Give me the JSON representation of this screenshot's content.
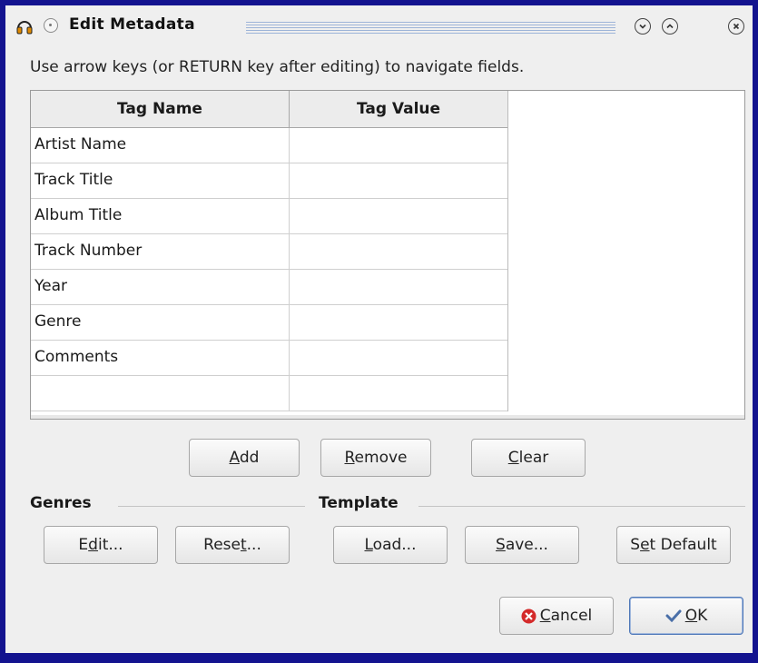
{
  "window": {
    "title": "Edit Metadata",
    "instructions": "Use arrow keys (or RETURN key after editing) to navigate fields."
  },
  "table": {
    "headers": [
      "Tag Name",
      "Tag Value"
    ],
    "rows": [
      {
        "name": "Artist Name",
        "value": ""
      },
      {
        "name": "Track Title",
        "value": ""
      },
      {
        "name": "Album Title",
        "value": ""
      },
      {
        "name": "Track Number",
        "value": ""
      },
      {
        "name": "Year",
        "value": ""
      },
      {
        "name": "Genre",
        "value": ""
      },
      {
        "name": "Comments",
        "value": ""
      },
      {
        "name": "",
        "value": ""
      }
    ]
  },
  "row_buttons": {
    "add": {
      "pre": "",
      "key": "A",
      "post": "dd"
    },
    "remove": {
      "pre": "",
      "key": "R",
      "post": "emove"
    },
    "clear": {
      "pre": "",
      "key": "C",
      "post": "lear"
    }
  },
  "genres": {
    "label": "Genres",
    "edit": {
      "pre": "E",
      "key": "d",
      "post": "it..."
    },
    "reset": {
      "pre": "Rese",
      "key": "t",
      "post": "..."
    }
  },
  "template": {
    "label": "Template",
    "load": {
      "pre": "",
      "key": "L",
      "post": "oad..."
    },
    "save": {
      "pre": "",
      "key": "S",
      "post": "ave..."
    },
    "set_default": {
      "pre": "S",
      "key": "e",
      "post": "t Default"
    }
  },
  "footer": {
    "cancel": {
      "pre": "",
      "key": "C",
      "post": "ancel"
    },
    "ok": {
      "pre": "",
      "key": "O",
      "post": "K"
    }
  },
  "colors": {
    "desktop": "#13138f",
    "cancel_icon": "#d42a2a",
    "ok_icon": "#4a6fa8"
  },
  "icons": {
    "app": "headphones-icon",
    "menu": "window-menu-icon",
    "minimize": "chevron-down-icon",
    "maximize": "chevron-up-icon",
    "close": "close-icon",
    "cancel": "cancel-icon",
    "ok": "checkmark-icon"
  }
}
